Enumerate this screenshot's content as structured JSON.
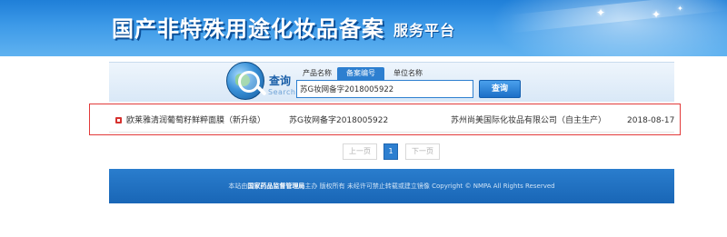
{
  "header": {
    "title": "国产非特殊用途化妆品备案",
    "subtitle": "服务平台"
  },
  "search": {
    "label": "查询",
    "label_en": "Search",
    "tabs": [
      {
        "label": "产品名称",
        "active": false
      },
      {
        "label": "备案编号",
        "active": true
      },
      {
        "label": "单位名称",
        "active": false
      }
    ],
    "input_value": "苏G妆网备字2018005922",
    "button_label": "查询"
  },
  "results": [
    {
      "product_name": "欧莱雅清润葡萄籽鲜粹面膜（新升级）",
      "record_no": "苏G妆网备字2018005922",
      "company": "苏州尚美国际化妆品有限公司（自主生产）",
      "date": "2018-08-17"
    }
  ],
  "pagination": {
    "prev_label": "上一页",
    "current_page": "1",
    "next_label": "下一页"
  },
  "footer": {
    "prefix": "本站由",
    "org": "国家药品监督管理局",
    "suffix": "主办 版权所有 未经许可禁止转载或建立镜像 Copyright © NMPA All Rights Reserved"
  },
  "colors": {
    "brand_blue": "#2d7fd0",
    "highlight_border": "#e23a3a",
    "bullet_red": "#d6322f"
  },
  "icons": {
    "search_globe": "globe-magnifier-icon",
    "result_bullet": "square-bullet-icon"
  }
}
